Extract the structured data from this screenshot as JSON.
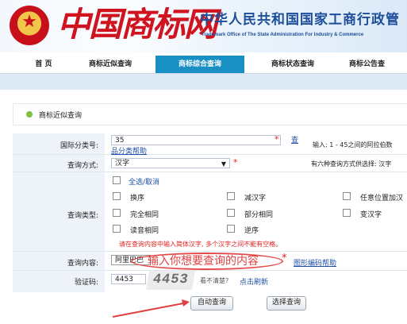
{
  "header": {
    "logo_text": "中国商标网",
    "office_cn": "中华人民共和国国家工商行政管",
    "office_en": "Trademark Office of The State Administration For Industry & Commerce"
  },
  "nav": {
    "items": [
      {
        "label": "首 页",
        "active": false
      },
      {
        "label": "商标近似查询",
        "active": false
      },
      {
        "label": "商标综合查询",
        "active": true
      },
      {
        "label": "商标状态查询",
        "active": false
      },
      {
        "label": "商标公告查",
        "active": false
      }
    ]
  },
  "panel": {
    "title": "商标近似查询"
  },
  "form": {
    "class_label": "国际分类号:",
    "class_value": "35",
    "class_link1": "查",
    "class_link2": "品分类帮助",
    "class_hint": "输入: 1 - 45之间的阿拉伯数",
    "method_label": "查询方式:",
    "method_value": "汉字",
    "method_hint": "有六种查询方式供选择: 汉字",
    "type_label": "查询类型:",
    "select_all": "全选/取消",
    "types": [
      "换序",
      "减汉字",
      "任意位置加汉",
      "完全相同",
      "部分相同",
      "变汉字",
      "读音相同",
      "逆序"
    ],
    "type_warning": "请在查询内容中输入简体汉字, 多个汉字之间不能有空格。",
    "content_label": "查询内容:",
    "content_value": "阿里巴巴",
    "content_annotation": "输入你想要查询的内容",
    "content_help": "图形编码帮助",
    "captcha_label": "验证码:",
    "captcha_value": "4453",
    "captcha_image_text": "4453",
    "captcha_hint": "看不清楚?",
    "captcha_refresh": "点击刷新",
    "auto_btn": "自动查询",
    "select_btn": "选择查询"
  },
  "colors": {
    "brand_red": "#cf1420",
    "nav_active": "#1a8fc4",
    "link": "#1d4ea8",
    "required": "#e02020"
  }
}
